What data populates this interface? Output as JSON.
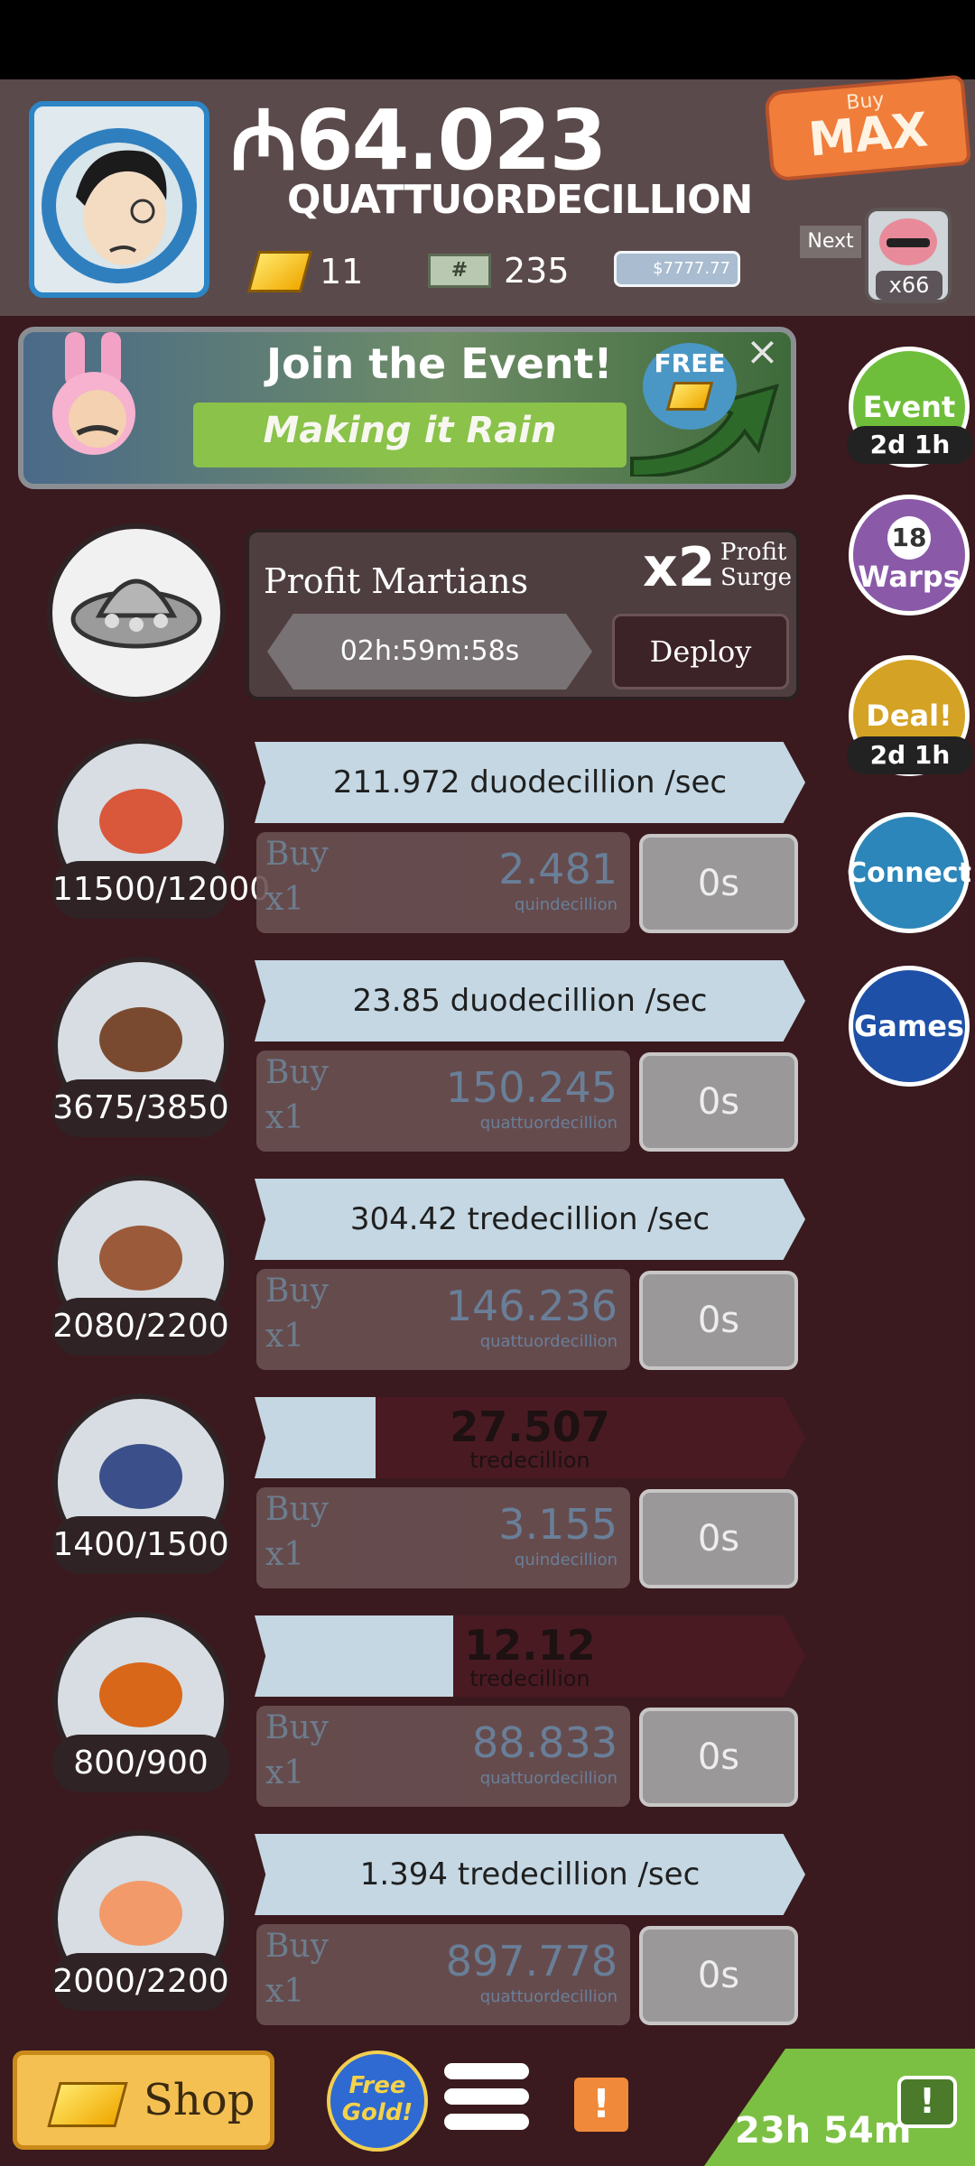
{
  "header": {
    "currency_symbol": "₼",
    "money_value": "64.023",
    "money_unit": "QUATTUORDECILLION",
    "gold_count": "11",
    "bills_count": "235",
    "megabucks_text": "$7777.77",
    "buymax_small": "Buy",
    "buymax_big": "MAX",
    "next_label": "Next",
    "next_multiplier": "x66"
  },
  "event_banner": {
    "title": "Join the Event!",
    "name": "Making it Rain",
    "free_badge": "FREE",
    "close": "×"
  },
  "side_buttons": [
    {
      "label": "Event",
      "sub": "2d 1h"
    },
    {
      "count": "18",
      "label": "Warps"
    },
    {
      "label": "Deal!",
      "sub": "2d 1h"
    },
    {
      "label": "Connect"
    },
    {
      "label": "Games"
    }
  ],
  "martians": {
    "title": "Profit Martians",
    "multiplier": "x2",
    "surge_line1": "Profit",
    "surge_line2": "Surge",
    "timer": "02h:59m:58s",
    "deploy": "Deploy"
  },
  "businesses": [
    {
      "count": "11500/12000",
      "mode": "rate",
      "rate": "211.972 duodecillion /sec",
      "buy": "Buy",
      "qty": "x1",
      "price": "2.481",
      "price_unit": "quindecillion",
      "time": "0s"
    },
    {
      "count": "3675/3850",
      "mode": "rate",
      "rate": "23.85 duodecillion /sec",
      "buy": "Buy",
      "qty": "x1",
      "price": "150.245",
      "price_unit": "quattuordecillion",
      "time": "0s"
    },
    {
      "count": "2080/2200",
      "mode": "rate",
      "rate": "304.42 tredecillion /sec",
      "buy": "Buy",
      "qty": "x1",
      "price": "146.236",
      "price_unit": "quattuordecillion",
      "time": "0s"
    },
    {
      "count": "1400/1500",
      "mode": "progress",
      "progress": 0.22,
      "value": "27.507",
      "value_unit": "tredecillion",
      "buy": "Buy",
      "qty": "x1",
      "price": "3.155",
      "price_unit": "quindecillion",
      "time": "0s"
    },
    {
      "count": "800/900",
      "mode": "progress",
      "progress": 0.36,
      "value": "12.12",
      "value_unit": "tredecillion",
      "buy": "Buy",
      "qty": "x1",
      "price": "88.833",
      "price_unit": "quattuordecillion",
      "time": "0s"
    },
    {
      "count": "2000/2200",
      "mode": "rate",
      "rate": "1.394 tredecillion /sec",
      "buy": "Buy",
      "qty": "x1",
      "price": "897.778",
      "price_unit": "quattuordecillion",
      "time": "0s"
    }
  ],
  "bottom": {
    "shop": "Shop",
    "free_gold": "Free Gold!",
    "alert": "!",
    "timer": "23h 54m",
    "tv_icon": "!"
  }
}
